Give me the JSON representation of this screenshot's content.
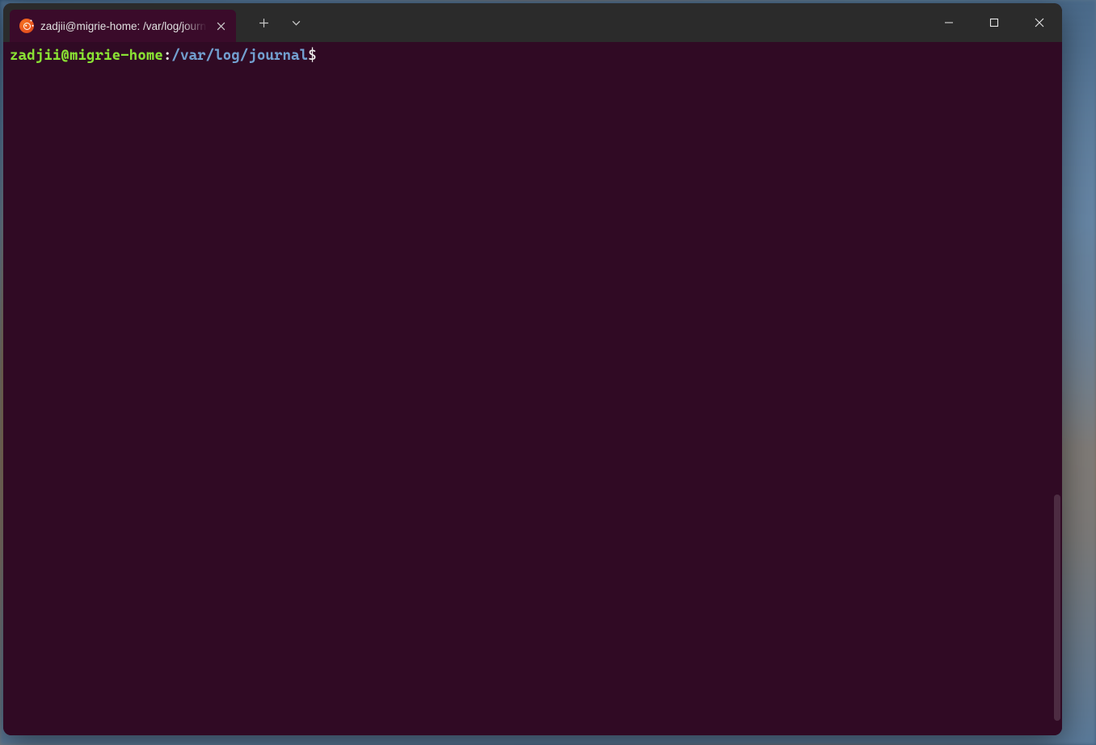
{
  "tab": {
    "title": "zadjii@migrie-home: /var/log/journal",
    "icon": "ubuntu-icon"
  },
  "prompt": {
    "user_host": "zadjii@migrie-home",
    "separator": ":",
    "path": "/var/log/journal",
    "symbol": "$"
  },
  "colors": {
    "terminal_bg": "#300a24",
    "titlebar_bg": "#2b2b2b",
    "prompt_user": "#8ae234",
    "prompt_path": "#729fcf"
  }
}
